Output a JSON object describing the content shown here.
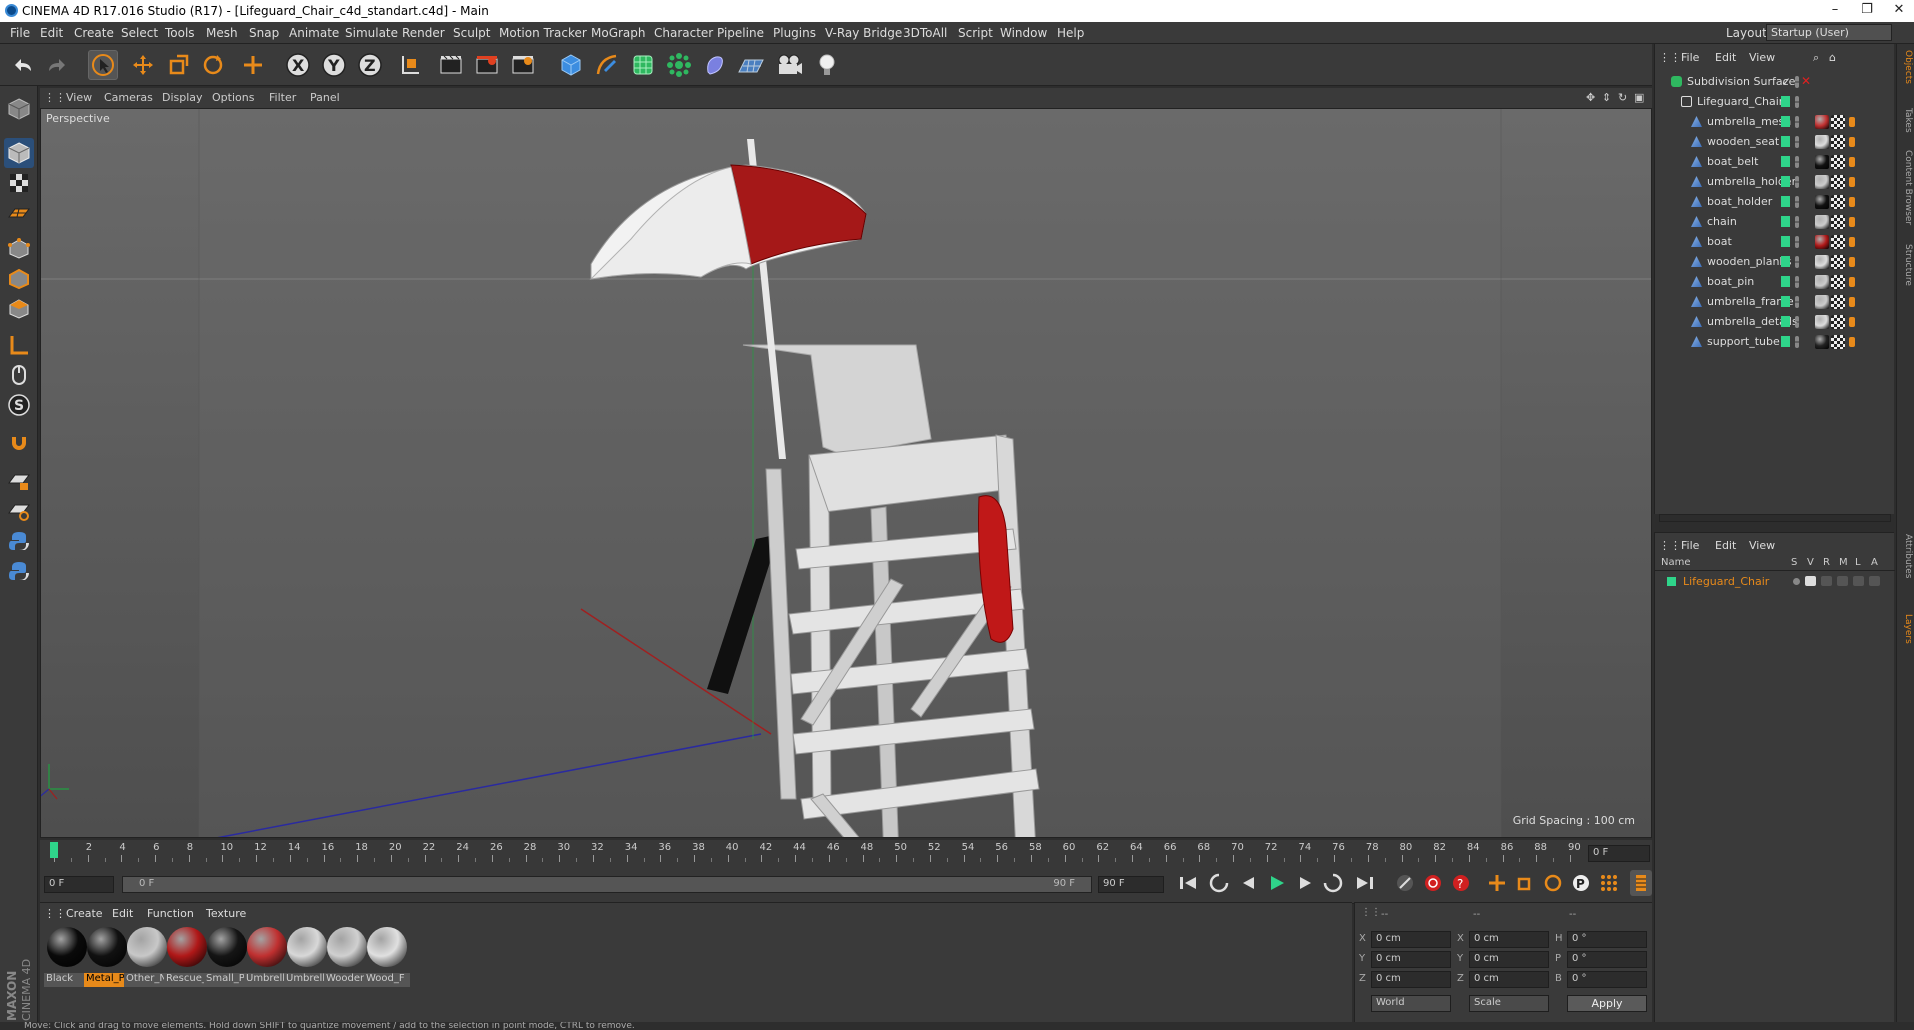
{
  "window": {
    "title": "CINEMA 4D R17.016 Studio (R17) - [Lifeguard_Chair_c4d_standart.c4d] - Main",
    "minimize": "–",
    "restore": "❐",
    "close": "✕"
  },
  "menu": [
    "File",
    "Edit",
    "Create",
    "Select",
    "Tools",
    "Mesh",
    "Snap",
    "Animate",
    "Simulate",
    "Render",
    "Sculpt",
    "Motion Tracker",
    "MoGraph",
    "Character",
    "Pipeline",
    "Plugins",
    "V-Ray Bridge",
    "3DToAll",
    "Script",
    "Window",
    "Help"
  ],
  "layout": {
    "label": "Layout:",
    "value": "Startup (User)"
  },
  "toolbar_icons": [
    "undo-icon",
    "redo-icon",
    "live-selection-icon",
    "move-icon",
    "scale-icon",
    "rotate-icon",
    "last-tool-icon",
    "x-axis-icon",
    "y-axis-icon",
    "z-axis-icon",
    "coordinate-system-icon",
    "render-view-icon",
    "render-picture-viewer-icon",
    "edit-render-settings-icon",
    "cube-icon",
    "pen-icon",
    "subdivision-icon",
    "array-icon",
    "deformer-icon",
    "floor-icon",
    "camera-icon",
    "light-icon"
  ],
  "viewport": {
    "menu": [
      "View",
      "Cameras",
      "Display",
      "Options",
      "Filter",
      "Panel"
    ],
    "label": "Perspective",
    "grid_spacing": "Grid Spacing : 100 cm"
  },
  "timeline": {
    "ticks": [
      "0",
      "2",
      "4",
      "6",
      "8",
      "10",
      "12",
      "14",
      "16",
      "18",
      "20",
      "22",
      "24",
      "26",
      "28",
      "30",
      "32",
      "34",
      "36",
      "38",
      "40",
      "42",
      "44",
      "46",
      "48",
      "50",
      "52",
      "54",
      "56",
      "58",
      "60",
      "62",
      "64",
      "66",
      "68",
      "70",
      "72",
      "74",
      "76",
      "78",
      "80",
      "82",
      "84",
      "86",
      "88",
      "90"
    ],
    "frame_field": "0 F",
    "current_frame": "0 F",
    "range_start": "0 F",
    "range_end": "90 F",
    "end_frame": "90 F"
  },
  "materials": {
    "menu": [
      "Create",
      "Edit",
      "Function",
      "Texture"
    ],
    "items": [
      {
        "label": "Black",
        "color": "#0a0a0a",
        "selected": false
      },
      {
        "label": "Metal_P",
        "color": "#111111",
        "selected": true
      },
      {
        "label": "Other_N",
        "color": "#c8c8c8",
        "selected": false
      },
      {
        "label": "Rescue_",
        "color": "#b01818",
        "selected": false
      },
      {
        "label": "Small_Pl",
        "color": "#151515",
        "selected": false
      },
      {
        "label": "Umbrell",
        "color": "#c03030",
        "selected": false
      },
      {
        "label": "Umbrell",
        "color": "#d8d8d8",
        "selected": false
      },
      {
        "label": "Wooder",
        "color": "#d0d0d0",
        "selected": false
      },
      {
        "label": "Wood_F",
        "color": "#e0e0e0",
        "selected": false
      }
    ]
  },
  "coordinates": {
    "headers": [
      "--",
      "--",
      "--"
    ],
    "rows": [
      {
        "a": "X",
        "av": "0 cm",
        "b": "X",
        "bv": "0 cm",
        "c": "H",
        "cv": "0 °"
      },
      {
        "a": "Y",
        "av": "0 cm",
        "b": "Y",
        "bv": "0 cm",
        "c": "P",
        "cv": "0 °"
      },
      {
        "a": "Z",
        "av": "0 cm",
        "b": "Z",
        "bv": "0 cm",
        "c": "B",
        "cv": "0 °"
      }
    ],
    "mode": "World",
    "size_mode": "Scale",
    "apply": "Apply"
  },
  "object_manager": {
    "menu": [
      "File",
      "Edit",
      "View"
    ],
    "objects": [
      {
        "name": "Subdivision Surface",
        "indent": 0,
        "tag": ""
      },
      {
        "name": "Lifeguard_Chair",
        "indent": 1,
        "tag": ""
      },
      {
        "name": "umbrella_mesh",
        "indent": 2,
        "tag": "#c23030"
      },
      {
        "name": "wooden_seat",
        "indent": 2,
        "tag": "#dddddd"
      },
      {
        "name": "boat_belt",
        "indent": 2,
        "tag": "#111111"
      },
      {
        "name": "umbrella_holder",
        "indent": 2,
        "tag": "#cccccc"
      },
      {
        "name": "boat_holder",
        "indent": 2,
        "tag": "#111111"
      },
      {
        "name": "chain",
        "indent": 2,
        "tag": "#cccccc"
      },
      {
        "name": "boat",
        "indent": 2,
        "tag": "#b01818"
      },
      {
        "name": "wooden_planks",
        "indent": 2,
        "tag": "#dddddd"
      },
      {
        "name": "boat_pin",
        "indent": 2,
        "tag": "#cccccc"
      },
      {
        "name": "umbrella_frame",
        "indent": 2,
        "tag": "#cccccc"
      },
      {
        "name": "umbrella_details",
        "indent": 2,
        "tag": "#dddddd"
      },
      {
        "name": "support_tube",
        "indent": 2,
        "tag": "#222222"
      }
    ]
  },
  "layer_manager": {
    "menu": [
      "File",
      "Edit",
      "View"
    ],
    "columns": [
      "Name",
      "S",
      "V",
      "R",
      "M",
      "L",
      "A"
    ],
    "layers": [
      {
        "name": "Lifeguard_Chair",
        "color": "#2fd48a"
      }
    ]
  },
  "right_tabs": [
    "Objects",
    "Takes",
    "Content Browser",
    "Structure",
    "Attributes",
    "Layers"
  ],
  "brand": {
    "maxon": "MAXON",
    "cinema": "CINEMA 4D"
  },
  "status": "Move: Click and drag to move elements. Hold down SHIFT to quantize movement / add to the selection in point mode, CTRL to remove."
}
